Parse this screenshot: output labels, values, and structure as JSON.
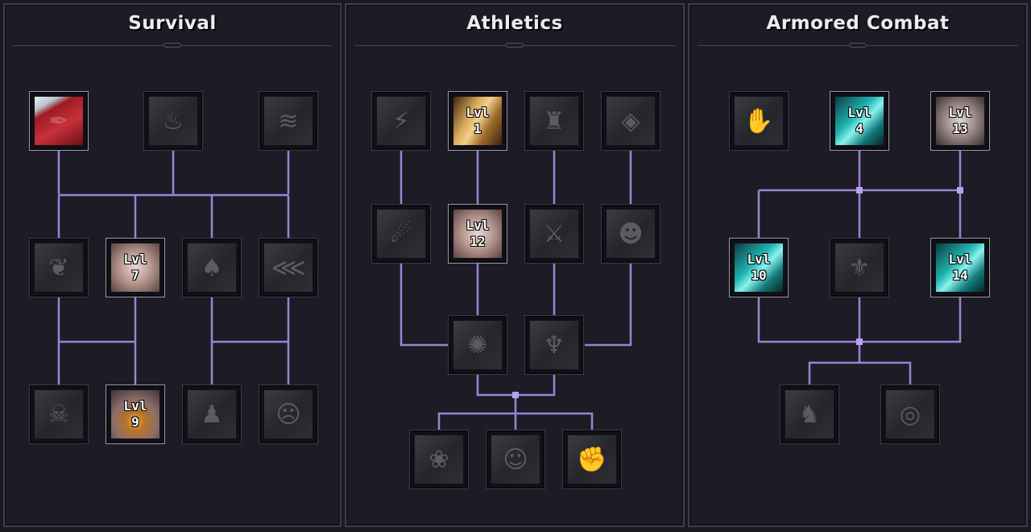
{
  "panels": [
    {
      "id": "survival",
      "title": "Survival",
      "nodes": [
        {
          "id": "s1",
          "icon": "bleeding-wound-icon",
          "level": "",
          "active": true,
          "art": "red"
        },
        {
          "id": "s2",
          "icon": "campfire-icon",
          "level": "",
          "active": false
        },
        {
          "id": "s3",
          "icon": "smoke-knife-icon",
          "level": "",
          "active": false
        },
        {
          "id": "s4",
          "icon": "leaf-icon",
          "level": "",
          "active": false
        },
        {
          "id": "s5",
          "icon": "mending-icon",
          "level": "Lvl\n7",
          "active": true,
          "art": "rose"
        },
        {
          "id": "s6",
          "icon": "flame-icon",
          "level": "",
          "active": false
        },
        {
          "id": "s7",
          "icon": "bent-arrow-icon",
          "level": "",
          "active": false
        },
        {
          "id": "s8",
          "icon": "wolf-skull-icon",
          "level": "",
          "active": false
        },
        {
          "id": "s9",
          "icon": "ember-burst-icon",
          "level": "Lvl\n9",
          "active": true,
          "art": "ember"
        },
        {
          "id": "s10",
          "icon": "silhouette-icon",
          "level": "",
          "active": false
        },
        {
          "id": "s11",
          "icon": "screaming-face-icon",
          "level": "",
          "active": false
        }
      ]
    },
    {
      "id": "athletics",
      "title": "Athletics",
      "nodes": [
        {
          "id": "a1",
          "icon": "running-legs-icon",
          "level": "",
          "active": false
        },
        {
          "id": "a2",
          "icon": "golden-wave-icon",
          "level": "Lvl\n1",
          "active": true,
          "art": "gold"
        },
        {
          "id": "a3",
          "icon": "back-muscles-icon",
          "level": "",
          "active": false
        },
        {
          "id": "a4",
          "icon": "arm-guard-icon",
          "level": "",
          "active": false
        },
        {
          "id": "a5",
          "icon": "sprinter-icon",
          "level": "",
          "active": false
        },
        {
          "id": "a6",
          "icon": "dash-icon",
          "level": "Lvl\n12",
          "active": true,
          "art": "rose"
        },
        {
          "id": "a7",
          "icon": "crossed-blades-icon",
          "level": "",
          "active": false
        },
        {
          "id": "a8",
          "icon": "beast-face-icon",
          "level": "",
          "active": false
        },
        {
          "id": "a9",
          "icon": "tumble-icon",
          "level": "",
          "active": false
        },
        {
          "id": "a10",
          "icon": "claw-icon",
          "level": "",
          "active": false
        },
        {
          "id": "a11",
          "icon": "lungs-icon",
          "level": "",
          "active": false
        },
        {
          "id": "a12",
          "icon": "stoic-face-icon",
          "level": "",
          "active": false
        },
        {
          "id": "a13",
          "icon": "flexed-arm-icon",
          "level": "",
          "active": false
        }
      ]
    },
    {
      "id": "armored-combat",
      "title": "Armored Combat",
      "nodes": [
        {
          "id": "c1",
          "icon": "gauntlet-grip-icon",
          "level": "",
          "active": false
        },
        {
          "id": "c2",
          "icon": "teal-slash-icon",
          "level": "Lvl\n4",
          "active": true,
          "art": "teal"
        },
        {
          "id": "c3",
          "icon": "spiked-helm-icon",
          "level": "Lvl\n13",
          "active": true,
          "art": "steel"
        },
        {
          "id": "c4",
          "icon": "teal-swirl-icon",
          "level": "Lvl\n10",
          "active": true,
          "art": "teal"
        },
        {
          "id": "c5",
          "icon": "armored-stride-icon",
          "level": "",
          "active": false
        },
        {
          "id": "c6",
          "icon": "teal-knight-icon",
          "level": "Lvl\n14",
          "active": true,
          "art": "teal"
        },
        {
          "id": "c7",
          "icon": "charging-knight-icon",
          "level": "",
          "active": false
        },
        {
          "id": "c8",
          "icon": "horn-coil-icon",
          "level": "",
          "active": false
        }
      ]
    }
  ],
  "colors": {
    "link": "#9b83d6",
    "panel_bg": "#1d1c26",
    "panel_border": "#3d3c4a"
  }
}
